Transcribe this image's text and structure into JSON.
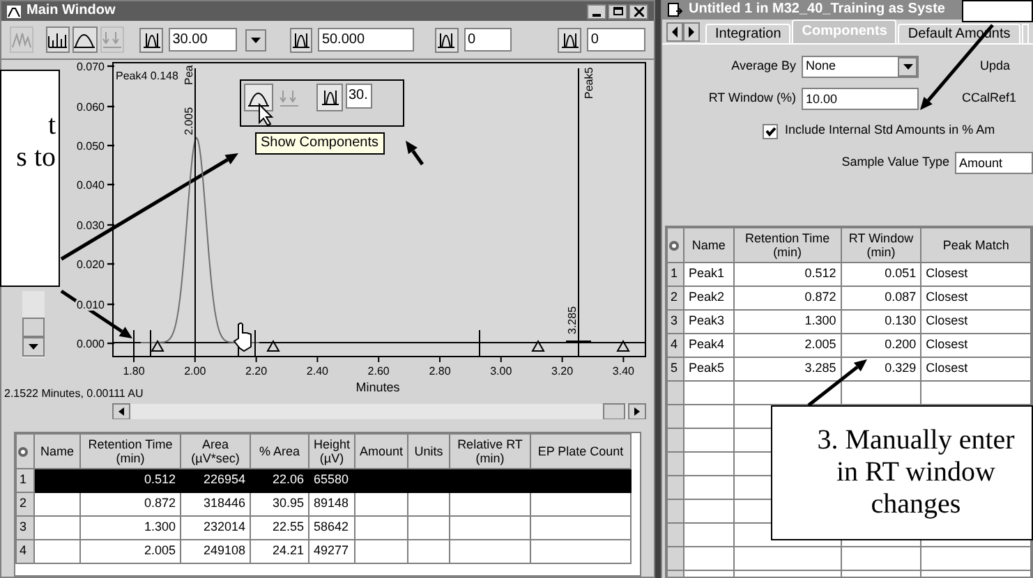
{
  "main_window": {
    "title": "Main Window",
    "toolbar": {
      "fields": [
        {
          "value": "30.00",
          "kind": "dropdown"
        },
        {
          "value": "50.000",
          "kind": "text"
        },
        {
          "value": "0",
          "kind": "text"
        },
        {
          "value": "0",
          "kind": "text"
        }
      ]
    },
    "chart": {
      "y_ticks": [
        "0.070",
        "0.060",
        "0.050",
        "0.040",
        "0.030",
        "0.020",
        "0.010",
        "0.000"
      ],
      "x_ticks": [
        "1.80",
        "2.00",
        "2.20",
        "2.40",
        "2.60",
        "2.80",
        "3.00",
        "3.20",
        "3.40"
      ],
      "x_label": "Minutes",
      "peak_labels": [
        {
          "text": "Peak4 0.148",
          "kind": "horizontal"
        },
        {
          "text": "Pea",
          "kind": "vertical"
        },
        {
          "text": "2.005",
          "kind": "vertical"
        },
        {
          "text": "Peak5",
          "kind": "vertical"
        },
        {
          "text": "3.285",
          "kind": "vertical"
        }
      ],
      "cursor_readout": "2.1522 Minutes, 0.00111 AU"
    },
    "toolbar_inset": {
      "field_value": "30.",
      "tooltip": "Show Components"
    },
    "table": {
      "columns": [
        "Name",
        "Retention Time (min)",
        "Area (µV*sec)",
        "% Area",
        "Height (µV)",
        "Amount",
        "Units",
        "Relative RT (min)",
        "EP Plate Count"
      ],
      "rows": [
        {
          "number": "1",
          "cells": [
            "",
            "0.512",
            "226954",
            "22.06",
            "65580",
            "",
            "",
            "",
            ""
          ],
          "selected": true
        },
        {
          "number": "2",
          "cells": [
            "",
            "0.872",
            "318446",
            "30.95",
            "89148",
            "",
            "",
            "",
            ""
          ],
          "selected": false
        },
        {
          "number": "3",
          "cells": [
            "",
            "1.300",
            "232014",
            "22.55",
            "58642",
            "",
            "",
            "",
            ""
          ],
          "selected": false
        },
        {
          "number": "4",
          "cells": [
            "",
            "2.005",
            "249108",
            "24.21",
            "49277",
            "",
            "",
            "",
            ""
          ],
          "selected": false
        }
      ]
    }
  },
  "method_window": {
    "title": "Untitled 1 in M32_40_Training as Syste",
    "tabs": [
      {
        "label": "Integration",
        "selected": false
      },
      {
        "label": "Components",
        "selected": true
      },
      {
        "label": "Default Amounts",
        "selected": false
      }
    ],
    "form": {
      "average_by": {
        "label": "Average By",
        "value": "None"
      },
      "update_label": "Upda",
      "rt_window": {
        "label": "RT Window (%)",
        "value": "10.00"
      },
      "ccalref_label": "CCalRef1",
      "include_istd": {
        "label": "Include Internal Std Amounts in % Am",
        "checked": true
      },
      "sample_value_type": {
        "label": "Sample Value Type",
        "value": "Amount"
      }
    },
    "table": {
      "columns": [
        "Name",
        "Retention Time (min)",
        "RT Window (min)",
        "Peak Match"
      ],
      "rows": [
        {
          "number": "1",
          "cells": [
            "Peak1",
            "0.512",
            "0.051",
            "Closest"
          ]
        },
        {
          "number": "2",
          "cells": [
            "Peak2",
            "0.872",
            "0.087",
            "Closest"
          ]
        },
        {
          "number": "3",
          "cells": [
            "Peak3",
            "1.300",
            "0.130",
            "Closest"
          ]
        },
        {
          "number": "4",
          "cells": [
            "Peak4",
            "2.005",
            "0.200",
            "Closest"
          ]
        },
        {
          "number": "5",
          "cells": [
            "Peak5",
            "3.285",
            "0.329",
            "Closest"
          ]
        }
      ]
    }
  },
  "callouts": [
    {
      "lines": [
        "t",
        "s to"
      ]
    },
    {
      "lines": [
        "3. Manually enter",
        "in RT window",
        "changes"
      ]
    }
  ]
}
